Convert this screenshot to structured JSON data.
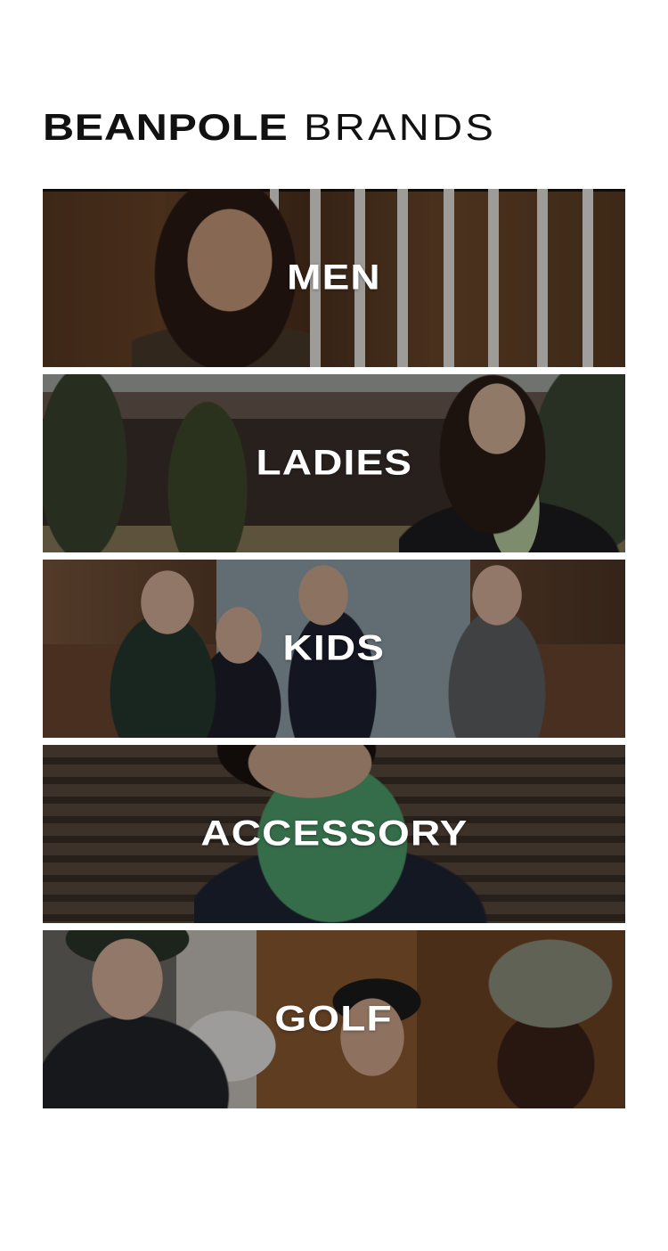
{
  "header": {
    "title_bold": "BEANPOLE",
    "title_light": "BRANDS"
  },
  "brands": [
    {
      "label": "MEN"
    },
    {
      "label": "LADIES"
    },
    {
      "label": "KIDS"
    },
    {
      "label": "ACCESSORY"
    },
    {
      "label": "GOLF"
    }
  ]
}
